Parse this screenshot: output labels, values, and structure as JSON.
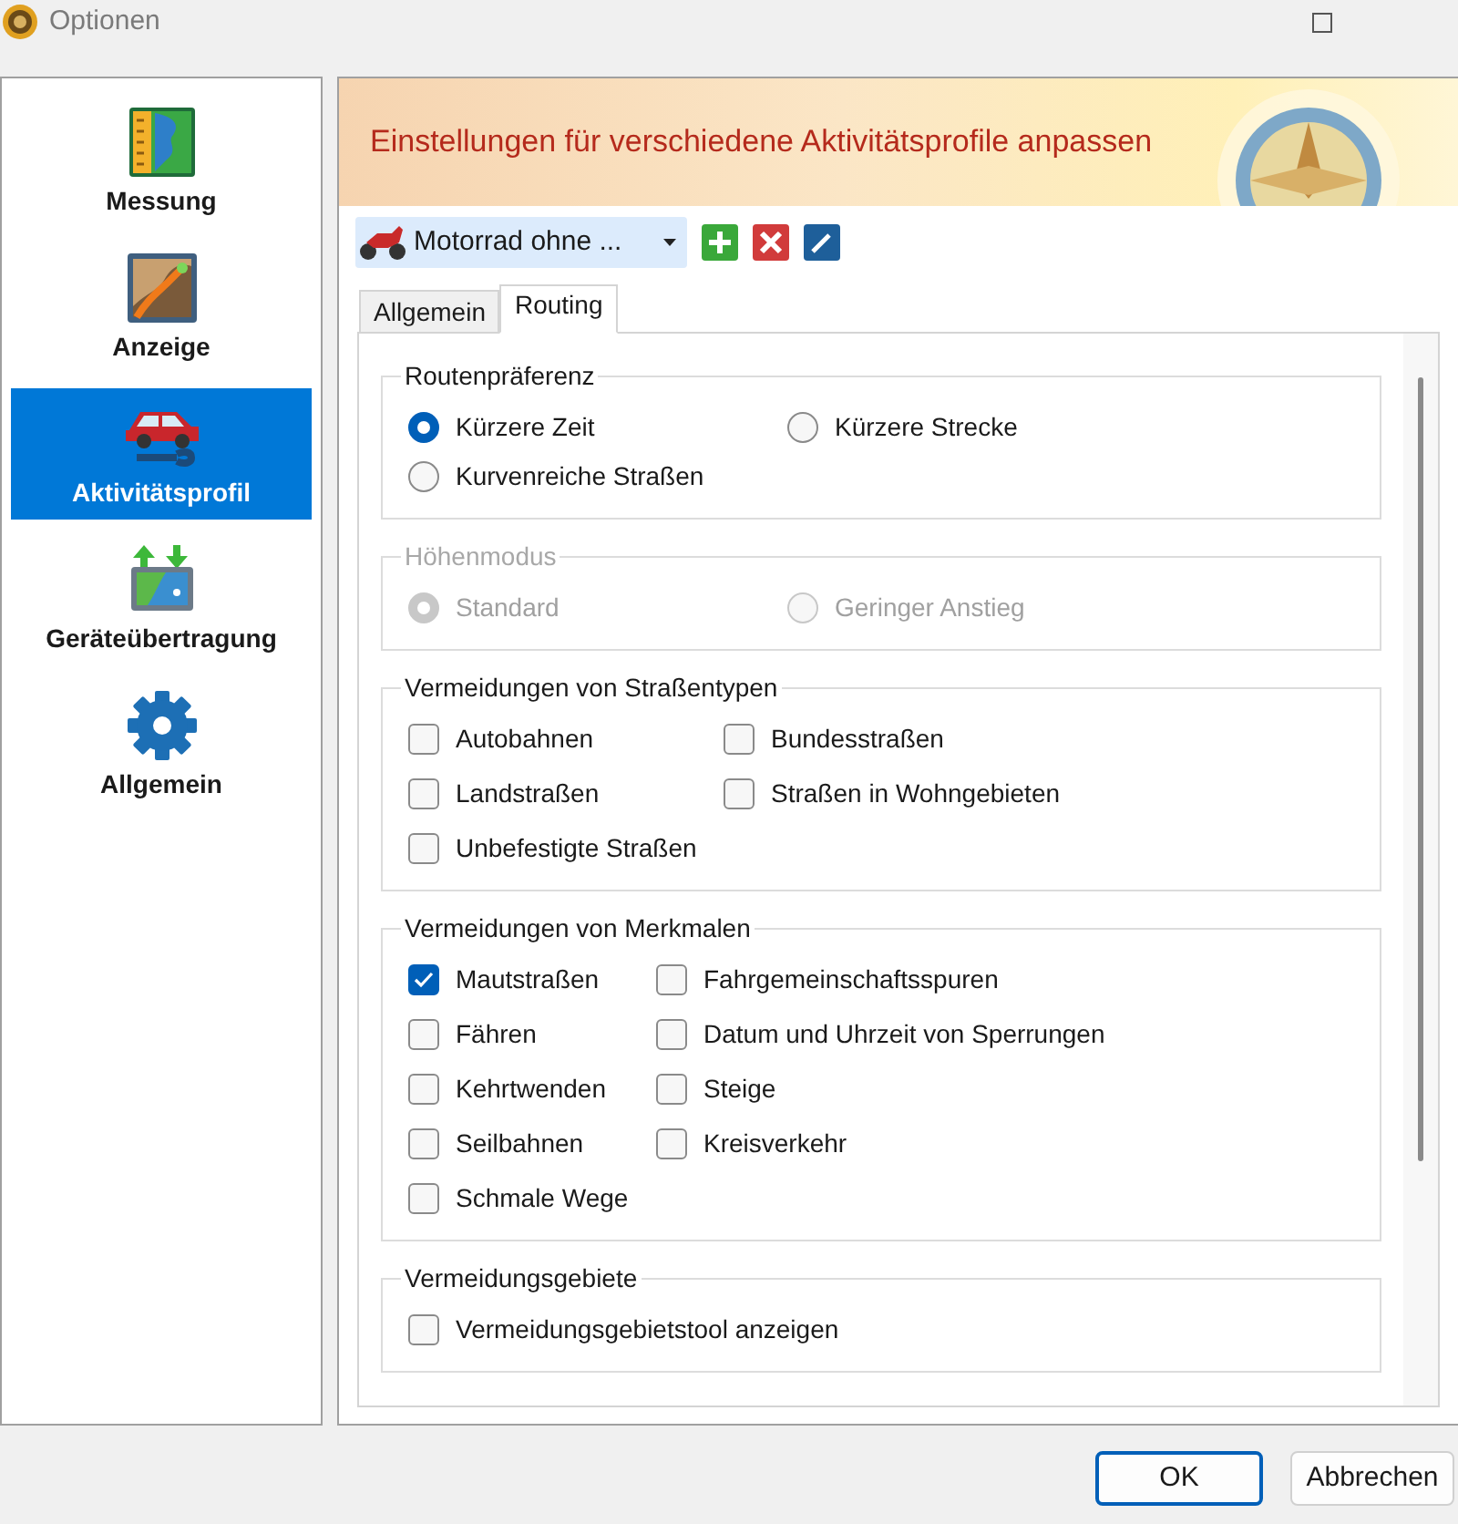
{
  "window": {
    "title": "Optionen"
  },
  "sidebar": {
    "items": [
      {
        "label": "Messung",
        "selected": false
      },
      {
        "label": "Anzeige",
        "selected": false
      },
      {
        "label": "Aktivitätsprofil",
        "selected": true
      },
      {
        "label": "Geräteübertragung",
        "selected": false
      },
      {
        "label": "Allgemein",
        "selected": false
      }
    ]
  },
  "header": {
    "title": "Einstellungen für verschiedene Aktivitätsprofile anpassen"
  },
  "profile_select": {
    "value": "Motorrad ohne ..."
  },
  "tabs": [
    {
      "label": "Allgemein",
      "selected": false
    },
    {
      "label": "Routing",
      "selected": true
    }
  ],
  "sections": [
    {
      "title": "Routenpräferenz",
      "kind": "radio",
      "disabled": false,
      "columns": [
        [
          {
            "label": "Kürzere Zeit",
            "selected": true
          },
          {
            "label": "Kurvenreiche Straßen",
            "selected": false
          }
        ],
        [
          {
            "label": "Kürzere Strecke",
            "selected": false
          }
        ]
      ]
    },
    {
      "title": "Höhenmodus",
      "kind": "radio",
      "disabled": true,
      "columns": [
        [
          {
            "label": "Standard",
            "selected": true
          }
        ],
        [
          {
            "label": "Geringer Anstieg",
            "selected": false
          }
        ]
      ]
    },
    {
      "title": "Vermeidungen von Straßentypen",
      "kind": "checkbox",
      "disabled": false,
      "columns": [
        [
          {
            "label": "Autobahnen",
            "checked": false
          },
          {
            "label": "Landstraßen",
            "checked": false
          },
          {
            "label": "Unbefestigte Straßen",
            "checked": false
          }
        ],
        [
          {
            "label": "Bundesstraßen",
            "checked": false
          },
          {
            "label": "Straßen in Wohngebieten",
            "checked": false
          }
        ]
      ]
    },
    {
      "title": "Vermeidungen von Merkmalen",
      "kind": "checkbox",
      "disabled": false,
      "columns": [
        [
          {
            "label": "Mautstraßen",
            "checked": true
          },
          {
            "label": "Fähren",
            "checked": false
          },
          {
            "label": "Kehrtwenden",
            "checked": false
          },
          {
            "label": "Seilbahnen",
            "checked": false
          },
          {
            "label": "Schmale Wege",
            "checked": false
          }
        ],
        [
          {
            "label": "Fahrgemeinschaftsspuren",
            "checked": false
          },
          {
            "label": "Datum und Uhrzeit von Sperrungen",
            "checked": false
          },
          {
            "label": "Steige",
            "checked": false
          },
          {
            "label": "Kreisverkehr",
            "checked": false
          }
        ]
      ]
    },
    {
      "title": "Vermeidungsgebiete",
      "kind": "checkbox",
      "disabled": false,
      "columns": [
        [
          {
            "label": "Vermeidungsgebietstool anzeigen",
            "checked": false
          }
        ]
      ]
    }
  ],
  "buttons": [
    {
      "label": "OK",
      "default": true
    },
    {
      "label": "Abbrechen",
      "default": false
    }
  ]
}
